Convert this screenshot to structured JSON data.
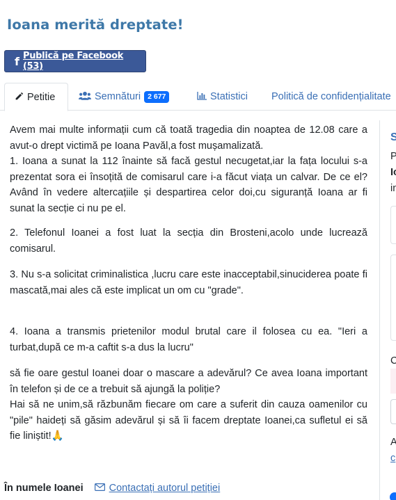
{
  "page": {
    "title": "Ioana merită dreptate!"
  },
  "share": {
    "facebook_label": "Publică pe Facebook (53)",
    "icon": "facebook-icon",
    "color": "#3b5998"
  },
  "tabs": [
    {
      "label": "Petitie",
      "icon": "pencil-icon",
      "active": true
    },
    {
      "label": "Semnături",
      "icon": "users-icon",
      "badge": "2 677"
    },
    {
      "label": "Statistici",
      "icon": "bar-chart-icon"
    },
    {
      "label": "Politică de confidențialitate"
    }
  ],
  "petition": {
    "paragraphs": [
      "Avem mai multe informații cum că toată tragedia din noaptea de 12.08 care a avut-o drept victimă pe Ioana Pavăl,a fost mușamalizată.\n1. Ioana a sunat la 112 înainte să facă gestul necugetat,iar la fața locului s-a prezentat sora ei însoțită de comisarul care i-a făcut viața un calvar. De ce el? Având în vedere altercațiile și despartirea celor doi,cu siguranță Ioana ar fi sunat la secție ci nu pe el.",
      "2. Telefonul Ioanei a fost luat la secția din Brosteni,acolo unde lucrează comisarul.",
      "3. Nu s-a solicitat criminalistica ,lucru care este inacceptabil,sinuciderea poate fi mascată,mai ales că este implicat un om cu \"grade\".",
      "4. Ioana a transmis prietenilor modul brutal care il folosea cu ea. \"Ieri a turbat,după ce m-a caftit s-a dus la lucru\"",
      "să fie oare gestul Ioanei doar o mascare a adevărul? Ce avea Ioana important în telefon și de ce a trebuit să ajungă la poliție?\nHai să ne unim,să răzbunăm fiecare om care a suferit din cauza oamenilor cu \"pile\" haideți să găsim adevărul și să îi facem dreptate Ioanei,ca sufletul ei să fie liniștit!🙏"
    ]
  },
  "footer": {
    "author": "În numele Ioanei",
    "contact_label": "Contactați autorul petiției",
    "contact_icon": "envelope-icon"
  },
  "sidebar": {
    "heading_initial": "S",
    "line1": "P",
    "line2": "Io",
    "line3": "in",
    "line4": "C",
    "line5": "A",
    "link": "c"
  },
  "colors": {
    "title": "#3e78a8",
    "link": "#3a6fb5",
    "badge": "#0d6efd"
  }
}
